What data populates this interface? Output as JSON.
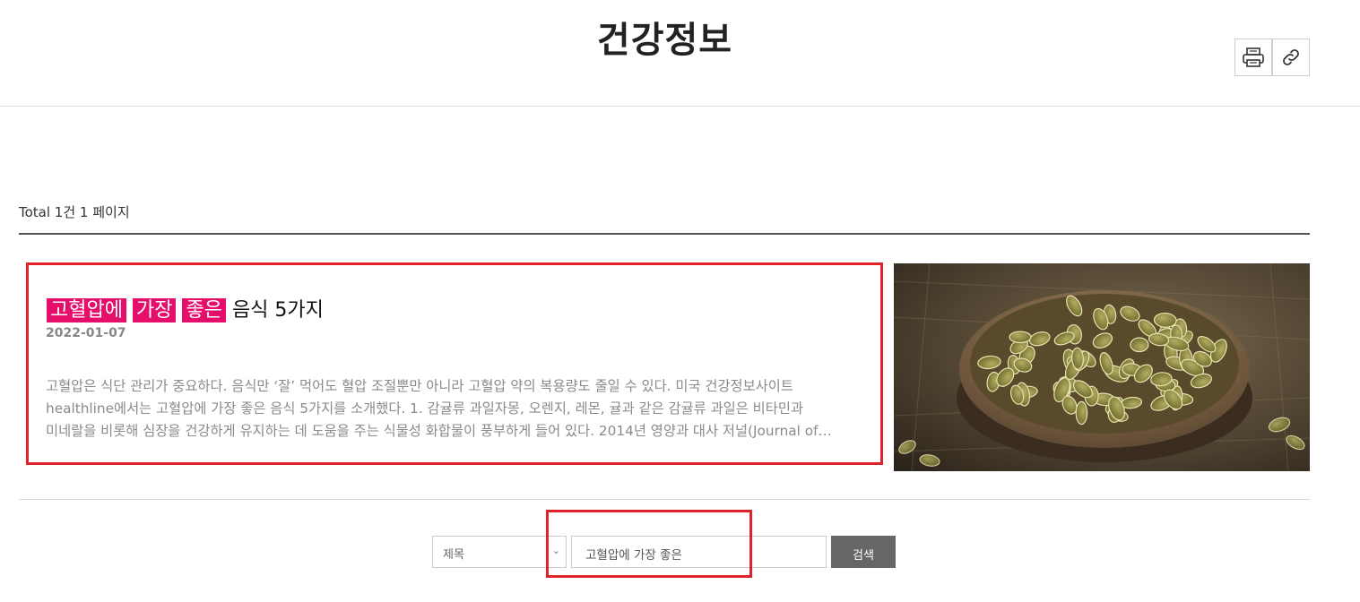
{
  "header": {
    "title": "건강정보",
    "print_icon": "print-icon",
    "link_icon": "link-icon"
  },
  "listing": {
    "total": "Total 1건 1 페이지"
  },
  "post": {
    "title_highlights": [
      "고혈압에",
      "가장",
      "좋은"
    ],
    "title_rest": "음식 5가지",
    "date": "2022-01-07",
    "excerpt_lines": [
      "고혈압은 식단 관리가 중요하다. 음식만 ‘잘’ 먹어도 혈압 조절뿐만 아니라 고혈압 약의 복용량도 줄일 수 있다. 미국 건강정보사이트",
      "healthline에서는 고혈압에 가장 좋은 음식 5가지를 소개했다. 1. 감귤류 과일자몽, 오렌지, 레몬, 귤과 같은 감귤류 과일은 비타민과",
      "미네랄을 비롯해 심장을 건강하게 유지하는 데 도움을 주는 식물성 화합물이 풍부하게 들어 있다. 2014년 영양과 대사 저널(Journal of…"
    ],
    "image": "pumpkin-seeds-bowl-photo",
    "highlight_color": "#e50f6b"
  },
  "search": {
    "field_select": "제목",
    "query": "고혈압에 가장 좋은",
    "button_label": "검색"
  },
  "colors": {
    "annotation_box": "#e0232a",
    "search_button": "#666666"
  }
}
